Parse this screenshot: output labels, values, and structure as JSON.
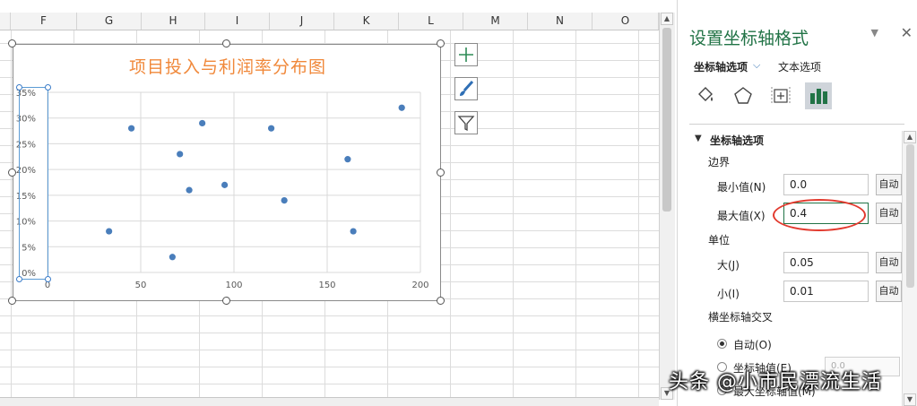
{
  "spreadsheet": {
    "columns": [
      "F",
      "G",
      "H",
      "I",
      "J",
      "K",
      "L",
      "M",
      "N",
      "O"
    ],
    "sheet_tabs": [
      "",
      ""
    ]
  },
  "chart": {
    "title": "项目投入与利润率分布图"
  },
  "chart_data": {
    "type": "scatter",
    "title": "项目投入与利润率分布图",
    "xlabel": "",
    "ylabel": "",
    "xlim": [
      0,
      200
    ],
    "ylim": [
      0,
      0.35
    ],
    "x_ticks": [
      "0",
      "50",
      "100",
      "150",
      "200"
    ],
    "y_ticks": [
      "0%",
      "5%",
      "10%",
      "15%",
      "20%",
      "25%",
      "30%",
      "35%"
    ],
    "grid": true,
    "color": "#4a7ebb",
    "points": [
      {
        "x": 33,
        "y": 0.08
      },
      {
        "x": 45,
        "y": 0.28
      },
      {
        "x": 67,
        "y": 0.03
      },
      {
        "x": 71,
        "y": 0.23
      },
      {
        "x": 76,
        "y": 0.16
      },
      {
        "x": 83,
        "y": 0.29
      },
      {
        "x": 95,
        "y": 0.17
      },
      {
        "x": 120,
        "y": 0.28
      },
      {
        "x": 127,
        "y": 0.14
      },
      {
        "x": 161,
        "y": 0.22
      },
      {
        "x": 164,
        "y": 0.08
      },
      {
        "x": 190,
        "y": 0.32
      }
    ]
  },
  "chart_buttons": {
    "add": "plus-icon",
    "style": "brush-icon",
    "filter": "filter-icon"
  },
  "format_pane": {
    "title": "设置坐标轴格式",
    "tab_axis": "坐标轴选项",
    "tab_text": "文本选项",
    "section_title": "坐标轴选项",
    "bounds_label": "边界",
    "min_label": "最小值(N)",
    "min_value": "0.0",
    "max_label": "最大值(X)",
    "max_value": "0.4",
    "units_label": "单位",
    "major_label": "大(J)",
    "major_value": "0.05",
    "minor_label": "小(I)",
    "minor_value": "0.01",
    "auto_label": "自动",
    "cross_label": "横坐标轴交叉",
    "cross_auto": "自动(O)",
    "cross_value": "坐标轴值(E)",
    "cross_max": "最大坐标轴值(M)",
    "cross_value_box": "0.0",
    "accent_color": "#217346",
    "highlight_color": "#e23a2e"
  },
  "watermark": "头条 @小市民漂流生活"
}
